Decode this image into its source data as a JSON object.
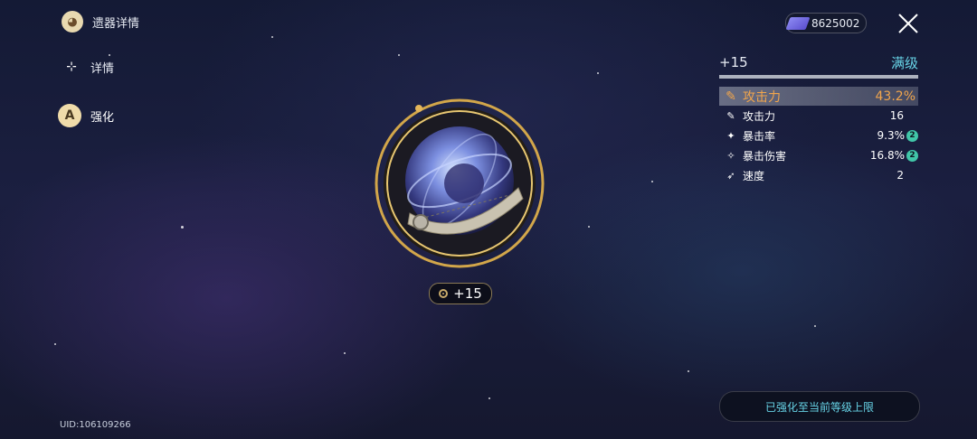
{
  "nav": {
    "items": [
      {
        "label": "遗器详情",
        "icon": "character-avatar-icon"
      },
      {
        "label": "详情",
        "icon": "detail-icon"
      },
      {
        "label": "强化",
        "icon": "enhance-icon"
      }
    ]
  },
  "uid": "UID:106109266",
  "currency": {
    "value": "8625002",
    "icon": "exp-material-icon"
  },
  "close": {
    "icon": "close-icon"
  },
  "relic": {
    "level": "+15",
    "icon": "relic-sphere-icon"
  },
  "stats": {
    "level": "+15",
    "max_label": "满级",
    "main": {
      "name": "攻击力",
      "value": "43.2%"
    },
    "sub": [
      {
        "name": "攻击力",
        "value": "16",
        "bonus": ""
      },
      {
        "name": "暴击率",
        "value": "9.3%",
        "bonus": "2"
      },
      {
        "name": "暴击伤害",
        "value": "16.8%",
        "bonus": "2"
      },
      {
        "name": "速度",
        "value": "2",
        "bonus": ""
      }
    ]
  },
  "notice": "已强化至当前等级上限",
  "colors": {
    "accent": "#67d3e6",
    "main_stat": "#f1a54c",
    "gold": "#c9ab6a"
  }
}
